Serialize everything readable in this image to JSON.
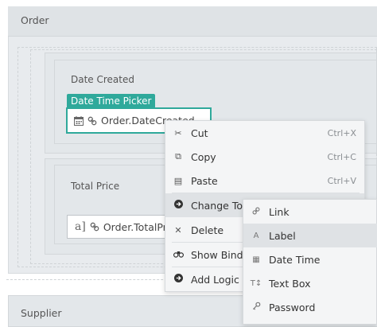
{
  "order": {
    "title": "Order"
  },
  "date_field": {
    "label": "Date Created",
    "badge": "Date Time Picker",
    "binding": "Order.DateCreated",
    "icon": "calendar-icon",
    "link_icon": "link-icon"
  },
  "price_field": {
    "label": "Total Price",
    "binding": "Order.TotalPrice",
    "icon": "label-type-icon",
    "link_icon": "link-icon"
  },
  "supplier": {
    "title": "Supplier"
  },
  "context_menu": {
    "items": [
      {
        "label": "Cut",
        "shortcut": "Ctrl+X",
        "icon": "scissors-icon"
      },
      {
        "label": "Copy",
        "shortcut": "Ctrl+C",
        "icon": "copy-icon"
      },
      {
        "label": "Paste",
        "shortcut": "Ctrl+V",
        "icon": "paste-icon"
      },
      {
        "label": "Change To",
        "shortcut": "",
        "icon": "arrow-circle-icon"
      },
      {
        "label": "Delete",
        "shortcut": "",
        "icon": "close-icon"
      },
      {
        "label": "Show Bindings",
        "shortcut": "",
        "icon": "binoculars-icon"
      },
      {
        "label": "Add Logic",
        "shortcut": "",
        "icon": "arrow-circle-icon"
      }
    ]
  },
  "submenu": {
    "items": [
      {
        "label": "Link",
        "icon": "link-icon"
      },
      {
        "label": "Label",
        "icon": "label-type-icon"
      },
      {
        "label": "Date Time",
        "icon": "calendar-icon"
      },
      {
        "label": "Text Box",
        "icon": "textbox-icon"
      },
      {
        "label": "Password",
        "icon": "key-icon"
      }
    ]
  },
  "colors": {
    "accent": "#2fa99b",
    "panel_bg": "#e8ebee",
    "menu_bg": "#f4f5f6",
    "menu_highlight": "#dfe2e5"
  }
}
